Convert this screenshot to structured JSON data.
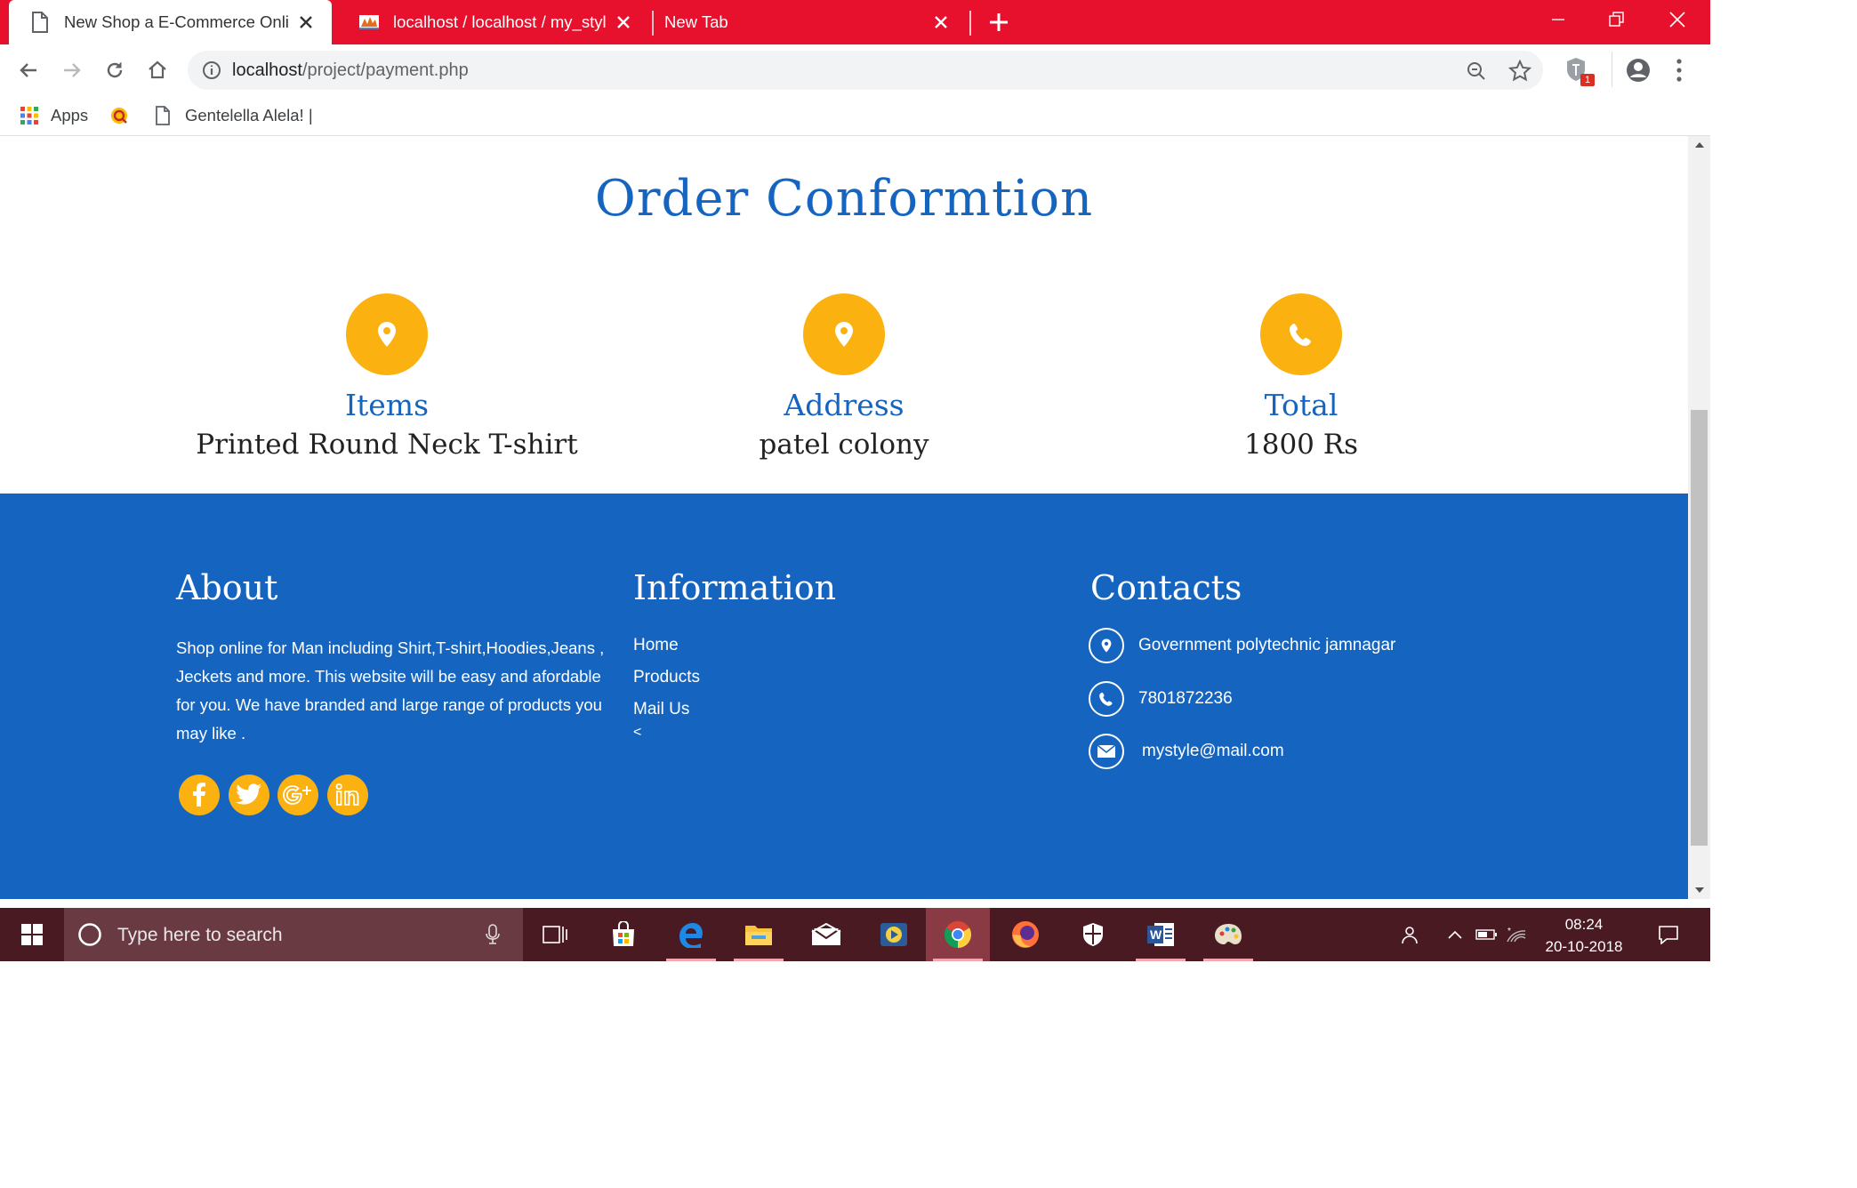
{
  "browser": {
    "tabs": [
      {
        "title": "New Shop a E-Commerce Online"
      },
      {
        "title": "localhost / localhost / my_style /"
      },
      {
        "title": "New Tab"
      }
    ],
    "url": {
      "host": "localhost",
      "path": "/project/payment.php"
    },
    "extension_badge": "1",
    "bookmarks": [
      {
        "label": "Apps",
        "icon": "apps-grid-icon"
      },
      {
        "label": "",
        "icon": "site-favicon"
      },
      {
        "label": "Gentelella Alela! |",
        "icon": "page-icon"
      }
    ]
  },
  "page": {
    "title": "Order Conformtion",
    "info": [
      {
        "label": "Items",
        "value": "Printed Round Neck T-shirt",
        "icon": "map-pin-icon"
      },
      {
        "label": "Address",
        "value": "patel colony",
        "icon": "map-pin-icon"
      },
      {
        "label": "Total",
        "value": "1800 Rs",
        "icon": "phone-icon"
      }
    ]
  },
  "footer": {
    "about": {
      "heading": "About",
      "text": "Shop online for Man including Shirt,T-shirt,Hoodies,Jeans , Jeckets and more. This website will be easy and afordable for you. We have branded and large range of products you may like .",
      "social": [
        "facebook-icon",
        "twitter-icon",
        "google-plus-icon",
        "linkedin-icon"
      ]
    },
    "information": {
      "heading": "Information",
      "links": [
        "Home",
        "Products",
        "Mail Us"
      ],
      "stray": "<"
    },
    "contacts": {
      "heading": "Contacts",
      "address": "Government polytechnic jamnagar",
      "phone": "7801872236",
      "email": "mystyle@mail.com"
    }
  },
  "taskbar": {
    "search_placeholder": "Type here to search",
    "time": "08:24",
    "date": "20-10-2018"
  },
  "colors": {
    "tab_strip": "#e8112d",
    "brand_blue": "#1565c0",
    "accent_orange": "#fbb10f",
    "taskbar": "#4a1a22"
  }
}
